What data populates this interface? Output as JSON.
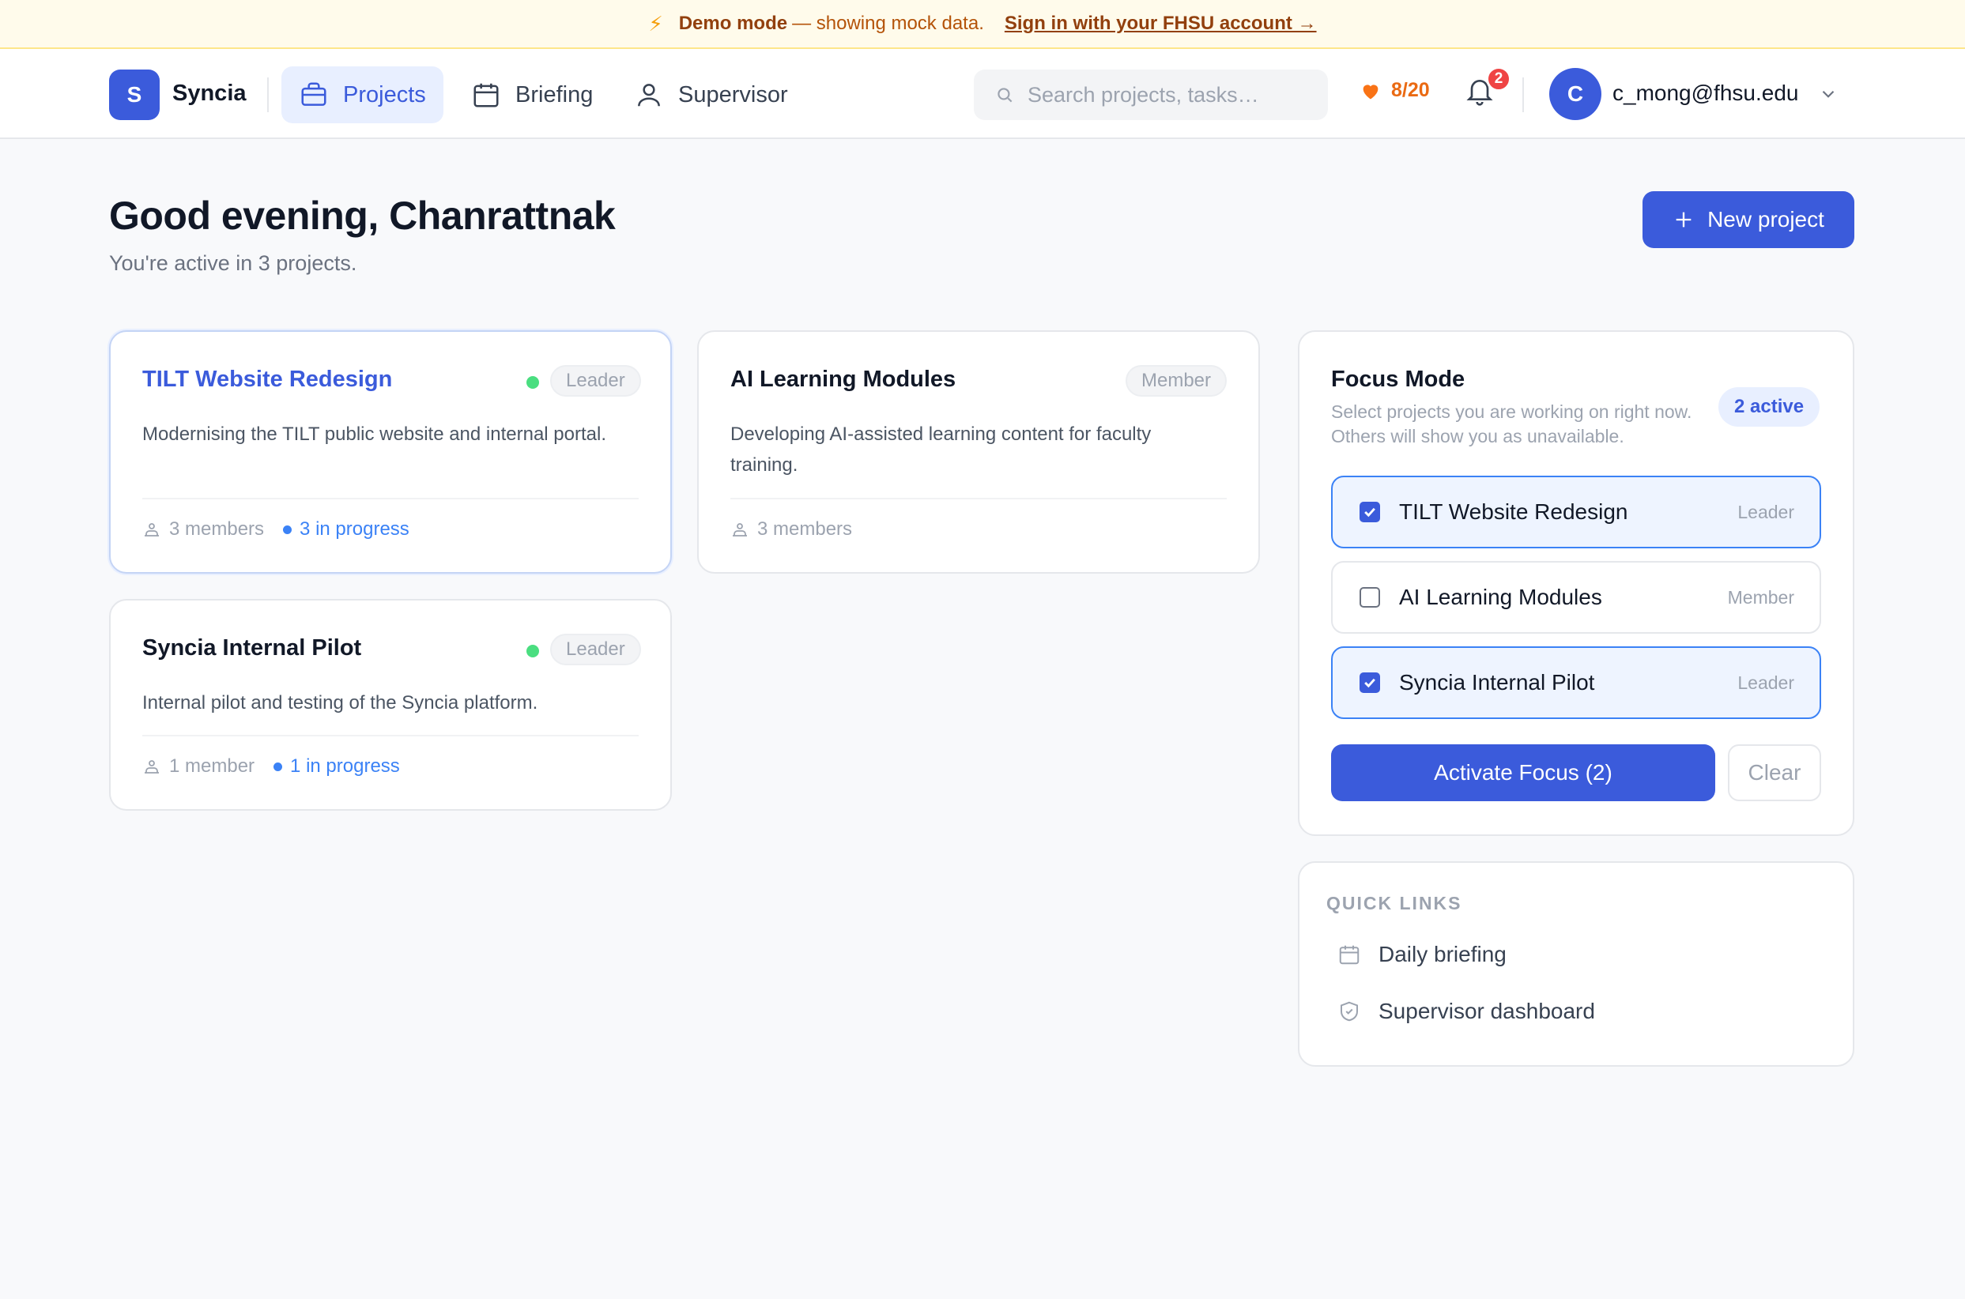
{
  "banner": {
    "icon": "lightning-icon",
    "strong": "Demo mode",
    "text": "— showing mock data.",
    "link": "Sign in with your FHSU account →"
  },
  "header": {
    "logo_letter": "S",
    "brand": "Syncia",
    "nav": [
      {
        "label": "Projects",
        "icon": "briefcase-icon",
        "active": true
      },
      {
        "label": "Briefing",
        "icon": "calendar-icon",
        "active": false
      },
      {
        "label": "Supervisor",
        "icon": "user-icon",
        "active": false
      }
    ],
    "search_placeholder": "Search projects, tasks…",
    "energy": "8/20",
    "notifications": "2",
    "avatar_letter": "C",
    "email": "c_mong@fhsu.edu"
  },
  "greeting": {
    "title": "Good evening, Chanrattnak",
    "subtitle": "You're active in 3 projects.",
    "new_project": "New project"
  },
  "projects": [
    {
      "title": "TILT Website Redesign",
      "role": "Leader",
      "active_dot": true,
      "description": "Modernising the TILT public website and internal portal.",
      "members": "3 members",
      "progress": "3 in progress"
    },
    {
      "title": "AI Learning Modules",
      "role": "Member",
      "active_dot": false,
      "description": "Developing AI-assisted learning content for faculty training.",
      "members": "3 members",
      "progress": ""
    },
    {
      "title": "Syncia Internal Pilot",
      "role": "Leader",
      "active_dot": true,
      "description": "Internal pilot and testing of the Syncia platform.",
      "members": "1 member",
      "progress": "1 in progress"
    }
  ],
  "focus": {
    "title": "Focus Mode",
    "description": "Select projects you are working on right now. Others will show you as unavailable.",
    "count": "2 active",
    "items": [
      {
        "name": "TILT Website Redesign",
        "role": "Leader",
        "checked": true
      },
      {
        "name": "AI Learning Modules",
        "role": "Member",
        "checked": false
      },
      {
        "name": "Syncia Internal Pilot",
        "role": "Leader",
        "checked": true
      }
    ],
    "activate": "Activate Focus (2)",
    "clear": "Clear"
  },
  "quick_links": {
    "heading": "QUICK LINKS",
    "items": [
      {
        "label": "Daily briefing",
        "icon": "calendar-icon"
      },
      {
        "label": "Supervisor dashboard",
        "icon": "shield-icon"
      }
    ]
  },
  "colors": {
    "accent": "#3b5bdb",
    "accent_light": "#e8efff",
    "success": "#4ade80",
    "banner_bg": "#fffbeb",
    "energy": "#ea6a13",
    "badge": "#ef4444"
  }
}
